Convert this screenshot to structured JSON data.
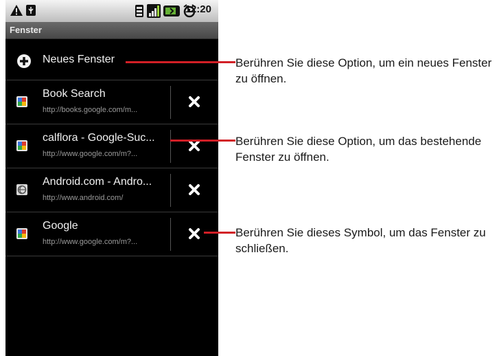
{
  "status_bar": {
    "time": "12:20",
    "icons": [
      "alert-icon",
      "usb-icon",
      "sd-card-icon",
      "signal-icon",
      "battery-icon",
      "alarm-icon"
    ]
  },
  "title_bar": {
    "title": "Fenster"
  },
  "new_window": {
    "label": "Neues Fenster",
    "icon": "plus-icon"
  },
  "windows": [
    {
      "title": "Book Search",
      "url": "http://books.google.com/m...",
      "icon": "google-favicon"
    },
    {
      "title": "calflora - Google-Suc...",
      "url": "http://www.google.com/m?...",
      "icon": "google-favicon"
    },
    {
      "title": "Android.com - Andro...",
      "url": "http://www.android.com/",
      "icon": "globe-icon"
    },
    {
      "title": "Google",
      "url": "http://www.google.com/m?...",
      "icon": "google-favicon"
    }
  ],
  "callouts": {
    "new_window": "Berühren Sie diese Option, um ein neues Fenster zu öffnen.",
    "open_window": "Berühren Sie diese Option, um das bestehende Fenster zu öffnen.",
    "close_window": "Berühren Sie dieses Symbol, um das Fenster zu schließen."
  },
  "colors": {
    "leader": "#d21f26",
    "screen_bg": "#000000",
    "close_icon": "#ffffff"
  }
}
